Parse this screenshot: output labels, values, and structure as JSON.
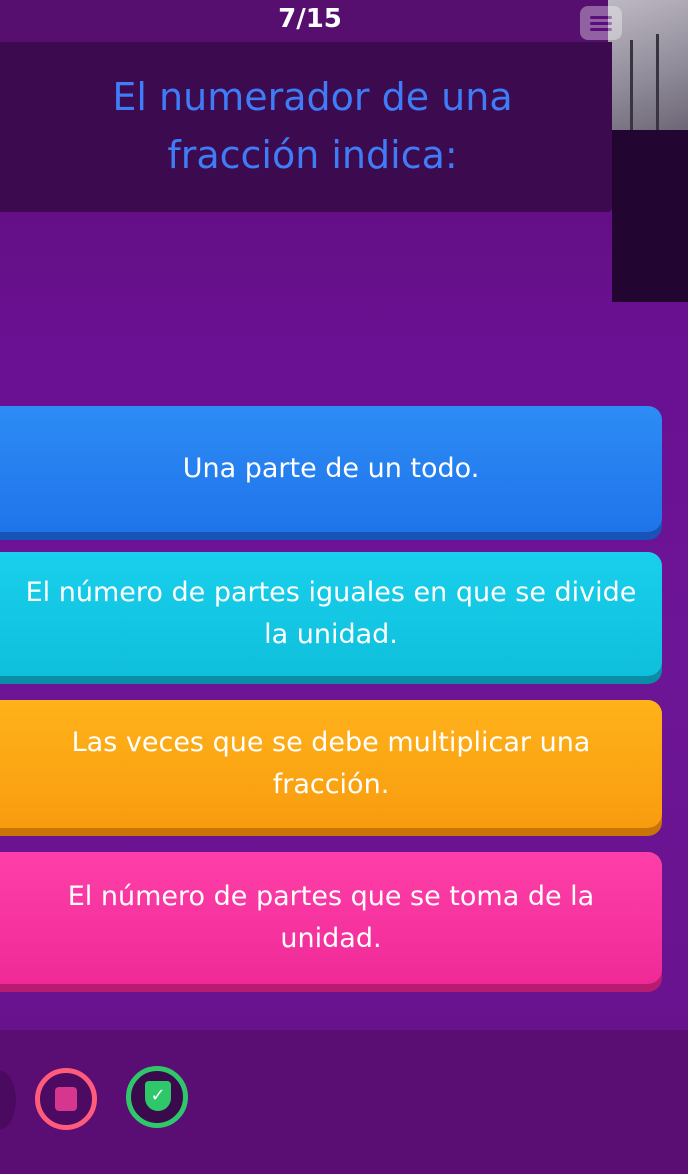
{
  "header": {
    "counter": "7/15"
  },
  "question": {
    "text": "El numerador de una fracción indica:"
  },
  "answers": [
    {
      "label": "Una parte de un todo.",
      "color": "#1f74ea"
    },
    {
      "label": "El número de partes iguales en que se divide la unidad.",
      "color": "#0fbfdc"
    },
    {
      "label": "Las veces que se debe multiplicar una fracción.",
      "color": "#f89c0f"
    },
    {
      "label": "El número de partes que se toma de la unidad.",
      "color": "#ef2a96"
    }
  ],
  "powerups": [
    {
      "icon": "powerup-icon"
    },
    {
      "icon": "shield-check-icon"
    }
  ],
  "theme": {
    "background": "#6a1092",
    "question_text": "#3f7cf7"
  }
}
